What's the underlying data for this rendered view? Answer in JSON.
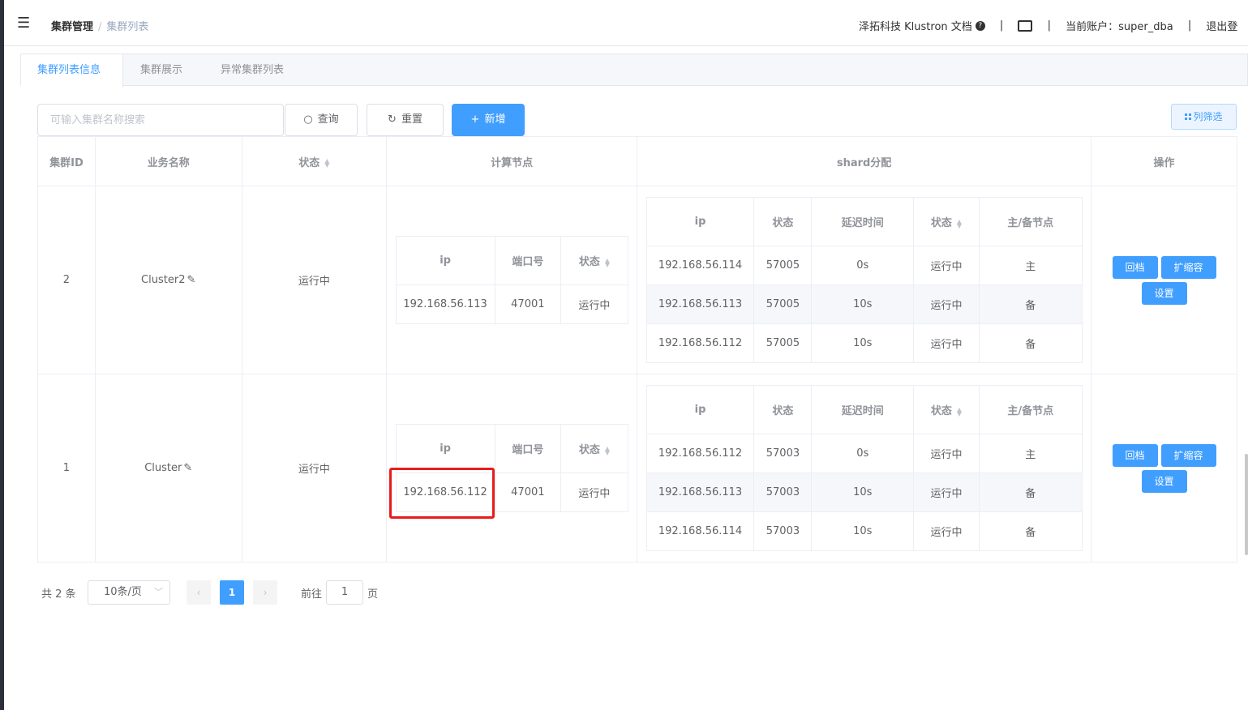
{
  "header": {
    "breadcrumb_root": "集群管理",
    "breadcrumb_sep": "/",
    "breadcrumb_current": "集群列表",
    "brand_docs": "泽拓科技 Klustron 文档",
    "divider": "|",
    "account_label": "当前账户：super_dba",
    "logout": "退出登"
  },
  "tabs": [
    "集群列表信息",
    "集群展示",
    "异常集群列表"
  ],
  "toolbar": {
    "search_placeholder": "可输入集群名称搜索",
    "query_label": "查询",
    "reset_label": "重置",
    "add_label": "新增",
    "filter_label": "列筛选"
  },
  "table": {
    "headers": {
      "id": "集群ID",
      "name": "业务名称",
      "status": "状态",
      "compute": "计算节点",
      "shard": "shard分配",
      "ops": "操作"
    },
    "compute_headers": {
      "ip": "ip",
      "port": "端口号",
      "status": "状态"
    },
    "shard_headers": {
      "ip": "ip",
      "status": "状态",
      "delay": "延迟时间",
      "state": "状态",
      "role": "主/备节点"
    },
    "ops_labels": {
      "rollback": "回档",
      "scale": "扩缩容",
      "settings": "设置"
    },
    "rows": [
      {
        "id": "2",
        "name": "Cluster2",
        "status": "运行中",
        "compute": [
          {
            "ip": "192.168.56.113",
            "port": "47001",
            "status": "运行中"
          }
        ],
        "shards": [
          {
            "ip": "192.168.56.114",
            "status": "57005",
            "delay": "0s",
            "state": "运行中",
            "role": "主"
          },
          {
            "ip": "192.168.56.113",
            "status": "57005",
            "delay": "10s",
            "state": "运行中",
            "role": "备"
          },
          {
            "ip": "192.168.56.112",
            "status": "57005",
            "delay": "10s",
            "state": "运行中",
            "role": "备"
          }
        ]
      },
      {
        "id": "1",
        "name": "Cluster",
        "status": "运行中",
        "compute": [
          {
            "ip": "192.168.56.112",
            "port": "47001",
            "status": "运行中"
          }
        ],
        "shards": [
          {
            "ip": "192.168.56.112",
            "status": "57003",
            "delay": "0s",
            "state": "运行中",
            "role": "主"
          },
          {
            "ip": "192.168.56.113",
            "status": "57003",
            "delay": "10s",
            "state": "运行中",
            "role": "备"
          },
          {
            "ip": "192.168.56.114",
            "status": "57003",
            "delay": "10s",
            "state": "运行中",
            "role": "备"
          }
        ]
      }
    ]
  },
  "pagination": {
    "total": "共 2 条",
    "page_size": "10条/页",
    "current_page": "1",
    "goto_label": "前往",
    "goto_value": "1",
    "page_suffix": "页"
  },
  "colors": {
    "primary": "#409eff",
    "success": "#67c23a",
    "highlight": "#e81c1c"
  }
}
